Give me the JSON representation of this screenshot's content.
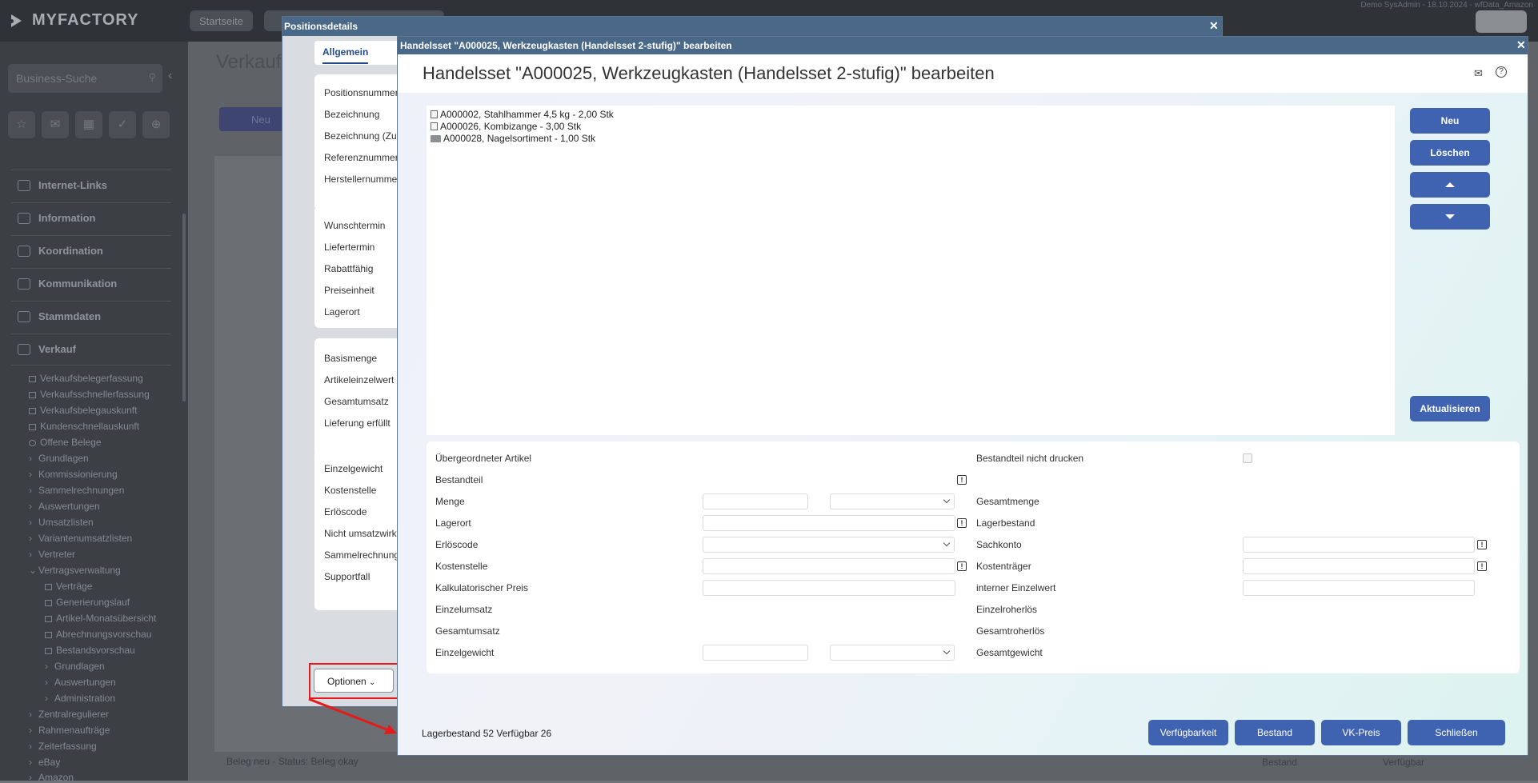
{
  "topbar": {
    "logo": "MYFACTORY",
    "tabs": [
      "Startseite"
    ],
    "info": "Demo SysAdmin - 18.10.2024 - wfData_Amazon"
  },
  "sidebar": {
    "search_placeholder": "Business-Suche",
    "sections": [
      "Internet-Links",
      "Information",
      "Koordination",
      "Kommunikation",
      "Stammdaten",
      "Verkauf"
    ],
    "items": [
      "Verkaufsbelegerfassung",
      "Verkaufsschnellerfassung",
      "Verkaufsbelegauskunft",
      "Kundenschnellauskunft",
      "Offene Belege",
      "Grundlagen",
      "Kommissionierung",
      "Sammelrechnungen",
      "Auswertungen",
      "Umsatzlisten",
      "Variantenumsatzlisten",
      "Vertreter",
      "Vertragsverwaltung",
      "Verträge",
      "Generierungslauf",
      "Artikel-Monatsübersicht",
      "Abrechnungsvorschau",
      "Bestandsvorschau",
      "Grundlagen",
      "Auswertungen",
      "Administration",
      "Zentralregulierer",
      "Rahmenaufträge",
      "Zeiterfassung",
      "eBay",
      "Amazon"
    ]
  },
  "background": {
    "title": "Verkaufs",
    "new_button": "Neu",
    "status": "Beleg neu - Status: Beleg okay",
    "col_bestand": "Bestand",
    "col_verfuegbar": "Verfügbar"
  },
  "pos_window": {
    "title": "Positionsdetails",
    "tab": "Allgemein",
    "group1": [
      "Positionsnummer",
      "Bezeichnung",
      "Bezeichnung (Zusatz)",
      "Referenznummer",
      "Herstellernummer"
    ],
    "group2": [
      "Wunschtermin",
      "Liefertermin",
      "Rabattfähig",
      "Preiseinheit",
      "Lagerort"
    ],
    "group3": [
      "Basismenge",
      "Artikeleinzelwert",
      "Gesamtumsatz",
      "Lieferung erfüllt"
    ],
    "group4": [
      "Einzelgewicht",
      "Kostenstelle",
      "Erlöscode",
      "Nicht umsatzwirksam",
      "Sammelrechnung",
      "Supportfall"
    ],
    "options_button": "Optionen"
  },
  "main_window": {
    "titlebar": "Handelsset \"A000025, Werkzeugkasten (Handelsset 2-stufig)\" bearbeiten",
    "heading": "Handelsset \"A000025, Werkzeugkasten (Handelsset 2-stufig)\" bearbeiten",
    "tree": [
      "A000002, Stahlhammer 4,5 kg - 2,00 Stk",
      "A000026, Kombizange - 3,00 Stk",
      "A000028, Nagelsortiment - 1,00 Stk"
    ],
    "buttons": {
      "new": "Neu",
      "delete": "Löschen",
      "refresh": "Aktualisieren"
    },
    "form_left": [
      "Übergeordneter Artikel",
      "Bestandteil",
      "Menge",
      "Lagerort",
      "Erlöscode",
      "Kostenstelle",
      "Kalkulatorischer Preis",
      "Einzelumsatz",
      "Gesamtumsatz",
      "Einzelgewicht"
    ],
    "form_right": [
      "Bestandteil nicht drucken",
      "Gesamtmenge",
      "Lagerbestand",
      "Sachkonto",
      "Kostenträger",
      "interner Einzelwert",
      "Einzelroherlös",
      "Gesamtroherlös",
      "Gesamtgewicht"
    ],
    "footer_text": "Lagerbestand 52 Verfügbar 26",
    "footer_buttons": [
      "Verfügbarkeit",
      "Bestand",
      "VK-Preis",
      "Schließen"
    ]
  },
  "colors": {
    "accent": "#3f63b0",
    "titlebar": "#4a6888",
    "highlight": "#e51a1a"
  }
}
